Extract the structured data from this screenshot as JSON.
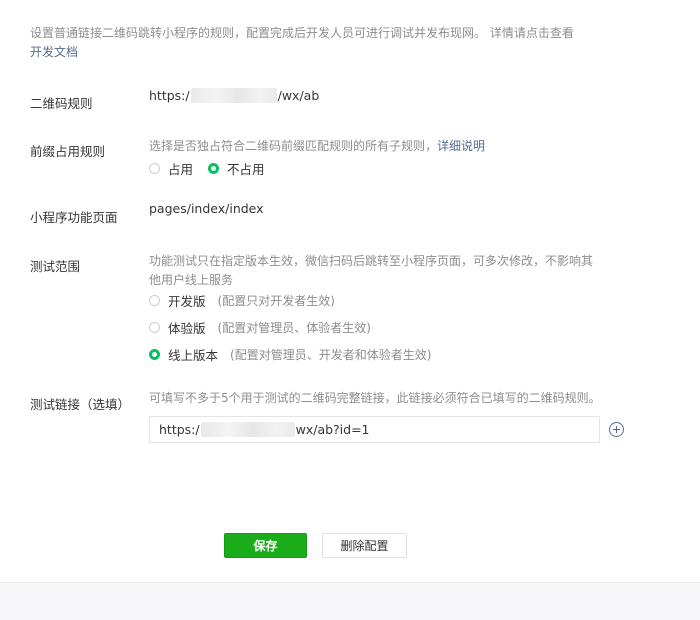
{
  "intro": {
    "text": "设置普通链接二维码跳转小程序的规则，配置完成后开发人员可进行调试并发布现网。 详情请点击查看",
    "link": "开发文档"
  },
  "qr_rule": {
    "label": "二维码规则",
    "prefix": "https:/",
    "suffix": "/wx/ab"
  },
  "prefix_rule": {
    "label": "前缀占用规则",
    "desc": "选择是否独占符合二维码前缀匹配规则的所有子规则，",
    "desc_link": "详细说明",
    "options": [
      {
        "label": "占用",
        "checked": false
      },
      {
        "label": "不占用",
        "checked": true
      }
    ]
  },
  "page": {
    "label": "小程序功能页面",
    "value": "pages/index/index"
  },
  "test_scope": {
    "label": "测试范围",
    "desc": "功能测试只在指定版本生效，微信扫码后跳转至小程序页面，可多次修改，不影响其他用户线上服务",
    "options": [
      {
        "label": "开发版",
        "hint": "(配置只对开发者生效)",
        "checked": false
      },
      {
        "label": "体验版",
        "hint": "(配置对管理员、体验者生效)",
        "checked": false
      },
      {
        "label": "线上版本",
        "hint": "(配置对管理员、开发者和体验者生效)",
        "checked": true
      }
    ]
  },
  "test_link": {
    "label": "测试链接（选填）",
    "desc": "可填写不多于5个用于测试的二维码完整链接，此链接必须符合已填写的二维码规则。",
    "value_prefix": "https:/",
    "value_suffix": "wx/ab?id=1"
  },
  "buttons": {
    "save": "保存",
    "delete": "删除配置"
  },
  "colors": {
    "accent": "#1aad19",
    "link": "#576b95",
    "radio_checked": "#07c160"
  }
}
